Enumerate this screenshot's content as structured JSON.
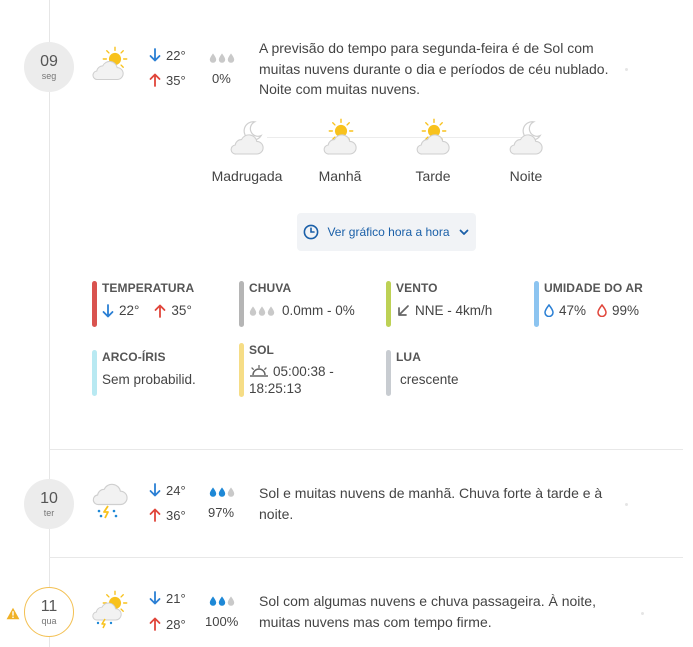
{
  "days": [
    {
      "day_num": "09",
      "weekday": "seg",
      "min": "22°",
      "max": "35°",
      "rain_prob": "0%",
      "description": "A previsão do tempo para segunda-feira é de Sol com muitas nuvens durante o dia e períodos de céu nublado. Noite com muitas nuvens.",
      "periods": [
        {
          "label": "Madrugada",
          "icon": "moon-cloud-icon"
        },
        {
          "label": "Manhã",
          "icon": "sun-cloud-icon"
        },
        {
          "label": "Tarde",
          "icon": "sun-cloud-icon"
        },
        {
          "label": "Noite",
          "icon": "moon-cloud-icon"
        }
      ],
      "graph_button": "Ver gráfico hora a hora",
      "details": {
        "temperatura": {
          "title": "TEMPERATURA",
          "min": "22°",
          "max": "35°",
          "color": "#d9534f"
        },
        "chuva": {
          "title": "CHUVA",
          "value": "0.0mm - 0%",
          "color": "#b5b5b5"
        },
        "vento": {
          "title": "VENTO",
          "value": "NNE - 4km/h",
          "color": "#bdd155"
        },
        "umidade": {
          "title": "UMIDADE DO AR",
          "min": "47%",
          "max": "99%",
          "color": "#8cc4f0"
        },
        "arco_iris": {
          "title": "ARCO-ÍRIS",
          "value": "Sem probabilid.",
          "color": "#b8e9f2"
        },
        "sol": {
          "title": "SOL",
          "value": "05:00:38 - 18:25:13",
          "color": "#f6dd86"
        },
        "lua": {
          "title": "LUA",
          "value": "crescente",
          "color": "#c8ccd1"
        }
      }
    },
    {
      "day_num": "10",
      "weekday": "ter",
      "min": "24°",
      "max": "36°",
      "rain_prob": "97%",
      "description": "Sol e muitas nuvens de manhã. Chuva forte à tarde e à noite."
    },
    {
      "day_num": "11",
      "weekday": "qua",
      "min": "21°",
      "max": "28°",
      "rain_prob": "100%",
      "description": "Sol com algumas nuvens e chuva passageira. À noite, muitas nuvens mas com tempo firme."
    }
  ],
  "colors": {
    "down_arrow": "#2a7fd4",
    "up_arrow": "#e0453a",
    "rain_drop": "#1e88d6",
    "drop_empty": "#c9c9c9",
    "sun": "#f8c21d",
    "cloud": "#dcdcdc",
    "warning": "#f0b127"
  }
}
